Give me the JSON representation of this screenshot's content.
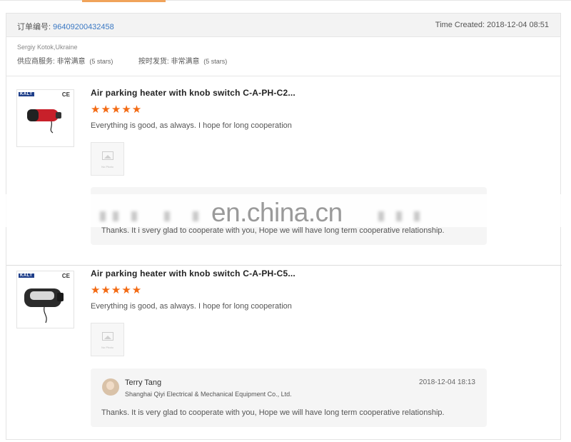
{
  "order": {
    "label": "订单编号:",
    "number": "96409200432458",
    "time_created": "Time Created: 2018-12-04 08:51"
  },
  "buyer": {
    "name": "Sergiy Kotok,Ukraine",
    "supplier_service_label": "供应商服务:",
    "supplier_service_value": "非常满意",
    "supplier_service_stars": "(5 stars)",
    "on_time_label": "按时发货:",
    "on_time_value": "非常满意",
    "on_time_stars": "(5 stars)"
  },
  "reviews": [
    {
      "product_title": "Air parking heater with knob switch C-A-PH-C2...",
      "rating": 5,
      "stars_text": "★★★★★",
      "comment": "Everything is good, as always. I hope for long cooperation",
      "photo_placeholder": "No Photo",
      "brand": "KALT",
      "cert": "CE",
      "product_color": "#c8202a",
      "reply": {
        "text": "Thanks. It i svery glad to cooperate with you, Hope we will have long term cooperative relationship."
      }
    },
    {
      "product_title": "Air parking heater with knob switch C-A-PH-C5...",
      "rating": 5,
      "stars_text": "★★★★★",
      "comment": "Everything is good, as always. I hope for long cooperation",
      "photo_placeholder": "No Photo",
      "brand": "KALT",
      "cert": "CE",
      "product_color": "#2b2b2b",
      "reply": {
        "author": "Terry Tang",
        "company": "Shanghai Qiyi Electrical & Mechanical Equipment Co., Ltd.",
        "date": "2018-12-04 18:13",
        "text": "Thanks. It is very glad to cooperate with you, Hope we will have long term cooperative relationship."
      }
    }
  ],
  "watermark": "en.china.cn",
  "colors": {
    "star": "#f36a13",
    "order_number": "#3a78c3",
    "active_tab": "#f0a35a"
  }
}
